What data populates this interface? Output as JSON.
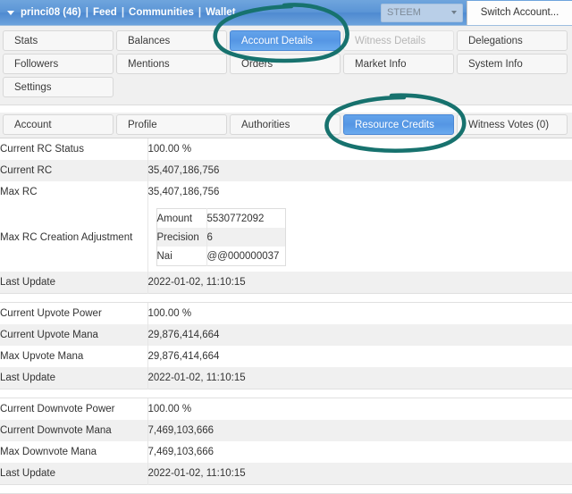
{
  "titlebar": {
    "account": "princi08 (46)",
    "sep": "|",
    "nav": [
      "Feed",
      "Communities",
      "Wallet"
    ],
    "chain_selected": "STEEM",
    "switch_account_label": "Switch Account...",
    "caret_icon": "caret-down-icon",
    "bg_color": "#5b95d6"
  },
  "primary_tabs": {
    "rows": [
      [
        {
          "label": "Stats",
          "state": "normal"
        },
        {
          "label": "Balances",
          "state": "normal"
        },
        {
          "label": "Account Details",
          "state": "active"
        },
        {
          "label": "Witness Details",
          "state": "disabled"
        },
        {
          "label": "Delegations",
          "state": "normal"
        }
      ],
      [
        {
          "label": "Followers",
          "state": "normal"
        },
        {
          "label": "Mentions",
          "state": "normal"
        },
        {
          "label": "Orders",
          "state": "normal"
        },
        {
          "label": "Market Info",
          "state": "normal"
        },
        {
          "label": "System Info",
          "state": "normal"
        }
      ],
      [
        {
          "label": "Settings",
          "state": "normal"
        },
        {
          "label": "",
          "state": "blank"
        },
        {
          "label": "",
          "state": "blank"
        },
        {
          "label": "",
          "state": "blank"
        },
        {
          "label": "",
          "state": "blank"
        }
      ]
    ]
  },
  "sub_tabs": [
    {
      "label": "Account",
      "state": "normal"
    },
    {
      "label": "Profile",
      "state": "normal"
    },
    {
      "label": "Authorities",
      "state": "normal"
    },
    {
      "label": "Resource Credits",
      "state": "active"
    },
    {
      "label": "Witness Votes (0)",
      "state": "normal"
    }
  ],
  "details": {
    "group_rc": [
      {
        "label": "Current RC Status",
        "value": "100.00 %"
      },
      {
        "label": "Current RC",
        "value": "35,407,186,756"
      },
      {
        "label": "Max RC",
        "value": "35,407,186,756"
      }
    ],
    "adjustment": {
      "label": "Max RC Creation Adjustment",
      "rows": [
        {
          "key": "Amount",
          "value": "5530772092"
        },
        {
          "key": "Precision",
          "value": "6"
        },
        {
          "key": "Nai",
          "value": "@@000000037"
        }
      ]
    },
    "rc_last_update": {
      "label": "Last Update",
      "value": "2022-01-02, 11:10:15"
    },
    "group_upvote": [
      {
        "label": "Current Upvote Power",
        "value": "100.00 %"
      },
      {
        "label": "Current Upvote Mana",
        "value": "29,876,414,664"
      },
      {
        "label": "Max Upvote Mana",
        "value": "29,876,414,664"
      },
      {
        "label": "Last Update",
        "value": "2022-01-02, 11:10:15"
      }
    ],
    "group_downvote": [
      {
        "label": "Current Downvote Power",
        "value": "100.00 %"
      },
      {
        "label": "Current Downvote Mana",
        "value": "7,469,103,666"
      },
      {
        "label": "Max Downvote Mana",
        "value": "7,469,103,666"
      },
      {
        "label": "Last Update",
        "value": "2022-01-02, 11:10:15"
      }
    ]
  },
  "annotations": {
    "color": "#17726e",
    "marks": [
      {
        "name": "circle-account-details",
        "target": "Account Details"
      },
      {
        "name": "circle-resource-credits",
        "target": "Resource Credits"
      }
    ]
  }
}
